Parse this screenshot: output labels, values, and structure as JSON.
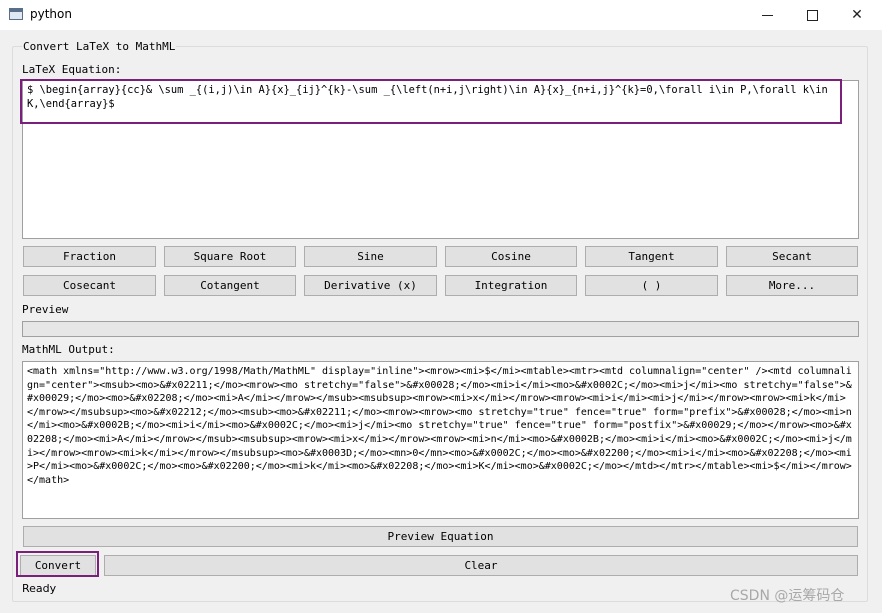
{
  "window": {
    "title": "python",
    "minimize": "–",
    "close": "✕"
  },
  "group": {
    "title": "Convert LaTeX to MathML"
  },
  "latex": {
    "label": "LaTeX Equation:",
    "value": "$ \\begin{array}{cc}& \\sum _{(i,j)\\in A}{x}_{ij}^{k}-\\sum _{\\left(n+i,j\\right)\\in A}{x}_{n+i,j}^{k}=0,\\forall i\\in P,\\forall k\\in K,\\end{array}$"
  },
  "buttons_row1": [
    "Fraction",
    "Square Root",
    "Sine",
    "Cosine",
    "Tangent",
    "Secant"
  ],
  "buttons_row2": [
    "Cosecant",
    "Cotangent",
    "Derivative (x)",
    "Integration",
    "( )",
    "More..."
  ],
  "preview": {
    "label": "Preview"
  },
  "mathml": {
    "label": "MathML Output:",
    "value": "<math xmlns=\"http://www.w3.org/1998/Math/MathML\" display=\"inline\"><mrow><mi>$</mi><mtable><mtr><mtd columnalign=\"center\" /><mtd columnalign=\"center\"><msub><mo>&#x02211;</mo><mrow><mo stretchy=\"false\">&#x00028;</mo><mi>i</mi><mo>&#x0002C;</mo><mi>j</mi><mo stretchy=\"false\">&#x00029;</mo><mo>&#x02208;</mo><mi>A</mi></mrow></msub><msubsup><mrow><mi>x</mi></mrow><mrow><mi>i</mi><mi>j</mi></mrow><mrow><mi>k</mi></mrow></msubsup><mo>&#x02212;</mo><msub><mo>&#x02211;</mo><mrow><mrow><mo stretchy=\"true\" fence=\"true\" form=\"prefix\">&#x00028;</mo><mi>n</mi><mo>&#x0002B;</mo><mi>i</mi><mo>&#x0002C;</mo><mi>j</mi><mo stretchy=\"true\" fence=\"true\" form=\"postfix\">&#x00029;</mo></mrow><mo>&#x02208;</mo><mi>A</mi></mrow></msub><msubsup><mrow><mi>x</mi></mrow><mrow><mi>n</mi><mo>&#x0002B;</mo><mi>i</mi><mo>&#x0002C;</mo><mi>j</mi></mrow><mrow><mi>k</mi></mrow></msubsup><mo>&#x0003D;</mo><mn>0</mn><mo>&#x0002C;</mo><mo>&#x02200;</mo><mi>i</mi><mo>&#x02208;</mo><mi>P</mi><mo>&#x0002C;</mo><mo>&#x02200;</mo><mi>k</mi><mo>&#x02208;</mo><mi>K</mi><mo>&#x0002C;</mo></mtd></mtr></mtable><mi>$</mi></mrow></math>"
  },
  "actions": {
    "preview_equation": "Preview Equation",
    "convert": "Convert",
    "clear": "Clear"
  },
  "status": "Ready",
  "watermark": "CSDN @运筹码仓",
  "colors": {
    "highlight": "#7a1f7a"
  }
}
